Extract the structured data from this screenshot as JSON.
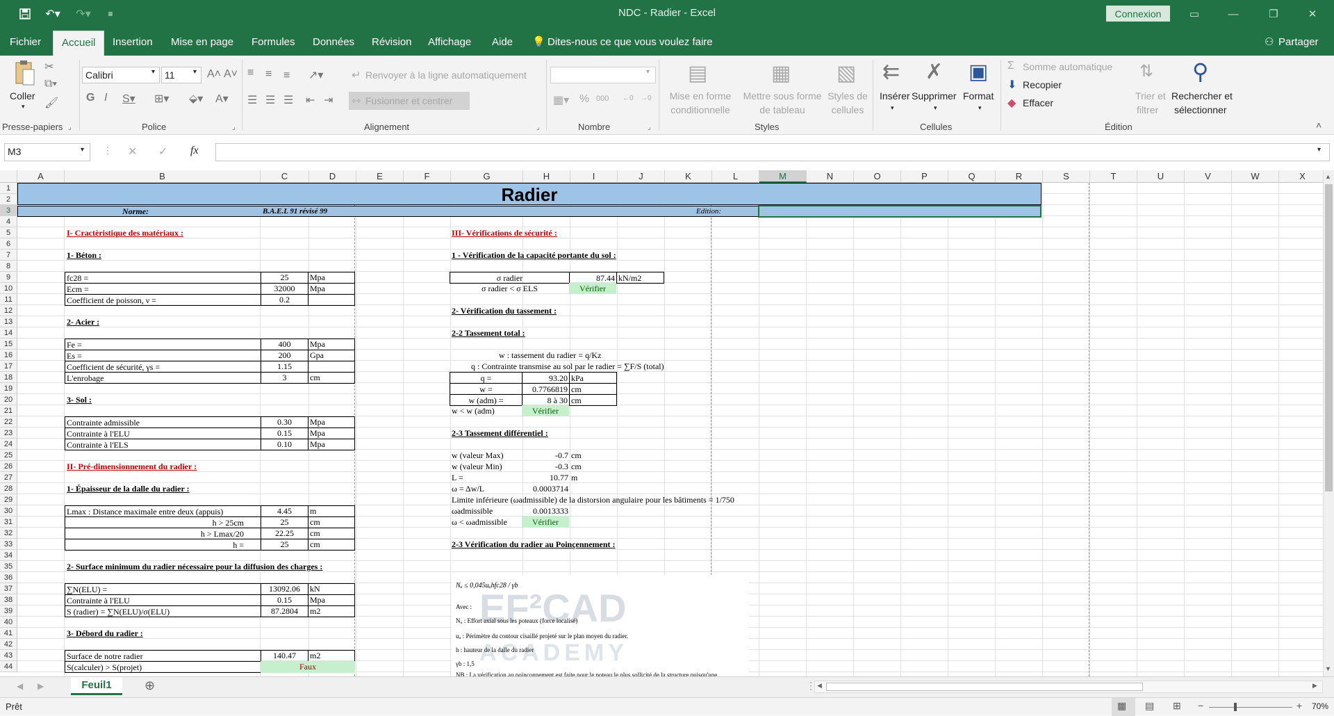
{
  "app": {
    "title": "NDC - Radier  -  Excel",
    "connexion": "Connexion"
  },
  "menu": {
    "tabs": [
      "Fichier",
      "Accueil",
      "Insertion",
      "Mise en page",
      "Formules",
      "Données",
      "Révision",
      "Affichage",
      "Aide"
    ],
    "tell_me": "Dites-nous ce que vous voulez faire",
    "share": "Partager"
  },
  "ribbon": {
    "coller": "Coller",
    "presse_papiers": "Presse-papiers",
    "font_name": "Calibri",
    "font_size": "11",
    "police": "Police",
    "renvoyer": "Renvoyer à la ligne automatiquement",
    "fusionner": "Fusionner et centrer",
    "alignement": "Alignement",
    "nombre": "Nombre",
    "mise_en_forme_1": "Mise en forme",
    "mise_en_forme_2": "conditionnelle",
    "mettre_1": "Mettre sous forme",
    "mettre_2": "de tableau",
    "styles_1": "Styles de",
    "styles_2": "cellules",
    "styles": "Styles",
    "inserer": "Insérer",
    "supprimer": "Supprimer",
    "format": "Format",
    "cellules": "Cellules",
    "somme": "Somme automatique",
    "recopier": "Recopier",
    "effacer": "Effacer",
    "trier_1": "Trier et",
    "trier_2": "filtrer",
    "rechercher_1": "Rechercher et",
    "rechercher_2": "sélectionner",
    "edition": "Édition"
  },
  "formula_bar": {
    "name_box": "M3",
    "fx": "fx",
    "value": ""
  },
  "columns": [
    "A",
    "B",
    "C",
    "D",
    "E",
    "F",
    "G",
    "H",
    "I",
    "J",
    "K",
    "L",
    "M",
    "N",
    "O",
    "P",
    "Q",
    "R",
    "S",
    "T",
    "U",
    "V",
    "W",
    "X"
  ],
  "rows": [
    "1",
    "2",
    "3",
    "4",
    "5",
    "6",
    "7",
    "8",
    "9",
    "10",
    "11",
    "12",
    "13",
    "14",
    "15",
    "16",
    "17",
    "18",
    "19",
    "20",
    "21",
    "22",
    "23",
    "24",
    "25",
    "26",
    "27",
    "28",
    "29",
    "30",
    "31",
    "32",
    "33",
    "34",
    "35",
    "36",
    "37",
    "38",
    "39",
    "40",
    "41",
    "42",
    "43",
    "44"
  ],
  "sheet": {
    "title": "Radier",
    "norme_label": "Norme:",
    "norme_value": "B.A.E.L 91 révisé 99",
    "edition_label": "Edition:",
    "s1": "I- Cractèristique des matériaux :",
    "beton": "1- Béton :",
    "fc28": "fc28 =",
    "fc28_v": "25",
    "mpa": "Mpa",
    "ecm": "Ecm =",
    "ecm_v": "32000",
    "poisson": "Coefficient de poisson, ν =",
    "poisson_v": "0.2",
    "acier": "2- Acier :",
    "fe": "Fe =",
    "fe_v": "400",
    "es": "Es =",
    "es_v": "200",
    "gpa": "Gpa",
    "coef": "Coefficient de sécurité, γs =",
    "coef_v": "1.15",
    "enrob": "L'enrobage",
    "enrob_v": "3",
    "cm": "cm",
    "sol": "3- Sol :",
    "cadm": "Contrainte admissible",
    "cadm_v": "0.30",
    "celu": "Contrainte à l'ELU",
    "celu_v": "0.15",
    "cels": "Contrainte à l'ELS",
    "cels_v": "0.10",
    "s2": "II- Pré-dimensionnement du radier :",
    "ep": "1- Épaisseur de la dalle du radier :",
    "lmax": "Lmax : Distance maximale entre deux (appuis)",
    "lmax_v": "4.45",
    "m": "m",
    "h1": "h > 25cm",
    "h1_v": "25",
    "h2": "h > Lmax/20",
    "h2_v": "22.25",
    "h3": "h =",
    "h3_v": "25",
    "surf": "2- Surface minimum du radier nécessaire pour la diffusion des charges :",
    "sumN": "∑N(ELU) =",
    "sumN_v": "13092.06",
    "kn": "kN",
    "celu2": "Contrainte à l'ELU",
    "celu2_v": "0.15",
    "srad": "S (radier) = ∑N(ELU)/σ(ELU)",
    "srad_v": "87.2804",
    "m2": "m2",
    "deb": "3- Débord du radier :",
    "snotre": "Surface de notre radier",
    "snotre_v": "140.47",
    "scalc": "S(calculer) > S(projet)",
    "faux": "Faux",
    "s3": "III- Vérifications de sécurité :",
    "v1": "1 - Vérification de la capacité portante du sol :",
    "sigma": "σ radier",
    "sigma_v": "87.44",
    "knm2": "kN/m2",
    "sigma_cmp": "σ radier < σ ELS",
    "verifier": "Vérifier",
    "v2": "2- Vérification du tassement :",
    "v22": "2-2 Tassement total :",
    "w_def": "w : tassement du radier = q/Kz",
    "q_def": "q : Contrainte transmise au sol par le radier = ∑F/S (total)",
    "q": "q =",
    "q_v": "93.20",
    "kpa": "kPa",
    "w": "w =",
    "w_v": "0.7766819",
    "wadm": "w (adm) =",
    "wadm_v": "8 à 30",
    "wcmp": "w < w (adm)",
    "v23": "2-3 Tassement différentiel :",
    "wmax": "w (valeur Max)",
    "wmax_v": "-0.7",
    "wmin": "w (valeur Min)",
    "wmin_v": "-0.3",
    "L": "L =",
    "L_v": "10.77",
    "omega": "ω = Δw/L",
    "omega_v": "0.0003714",
    "limite": "Limite inférieure (ωadmissible) de la distorsion angulaire pour les bâtiments = 1/750",
    "oadm": "ωadmissible",
    "oadm_v": "0.0013333",
    "ocmp": "ω < ωadmissible",
    "v24": "2-3 Vérification du radier au Poinçennement :",
    "img_formula": "Nᵤ ≤ 0,045uᵤhfc28 / γb",
    "img_avec": "Avec :",
    "img_l1": "Nᵤ : Effort axial sous les poteaux (force localisé)",
    "img_l2": "uᵤ : Périmètre du contour cisaillé projeté sur le plan moyen du radier.",
    "img_l3": "h : hauteur de la dalle du radier",
    "img_l4": "γb : 1,5",
    "img_l5": "NB : La vérification au poinçonnement est faite pour le poteau le plus sollicité de la structure puisqu'une",
    "watermark": "EF²CAD",
    "watermark2": "ACADEMY"
  },
  "sheet_tab": "Feuil1",
  "status": {
    "ready": "Prêt",
    "zoom": "70%"
  }
}
